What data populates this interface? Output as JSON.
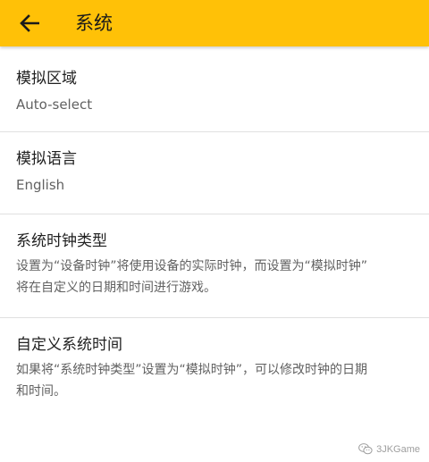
{
  "colors": {
    "app_bar": "#FFC107",
    "title_text": "#212121",
    "secondary_text": "#616161",
    "divider": "#e0e0e0"
  },
  "header": {
    "back_icon": "arrow-left-icon",
    "title": "系统"
  },
  "settings": [
    {
      "title": "模拟区域",
      "value": "Auto-select"
    },
    {
      "title": "模拟语言",
      "value": "English"
    },
    {
      "title": "系统时钟类型",
      "description_lines": [
        "设置为“设备时钟”将使用设备的实际时钟，而设置为“模拟时钟”",
        "将在自定义的日期和时间进行游戏。"
      ]
    },
    {
      "title": "自定义系统时间",
      "description_lines": [
        "如果将“系统时钟类型”设置为“模拟时钟”，可以修改时钟的日期",
        "和时间。"
      ]
    }
  ],
  "watermark": {
    "icon": "wechat-icon",
    "text": "3JKGame"
  }
}
